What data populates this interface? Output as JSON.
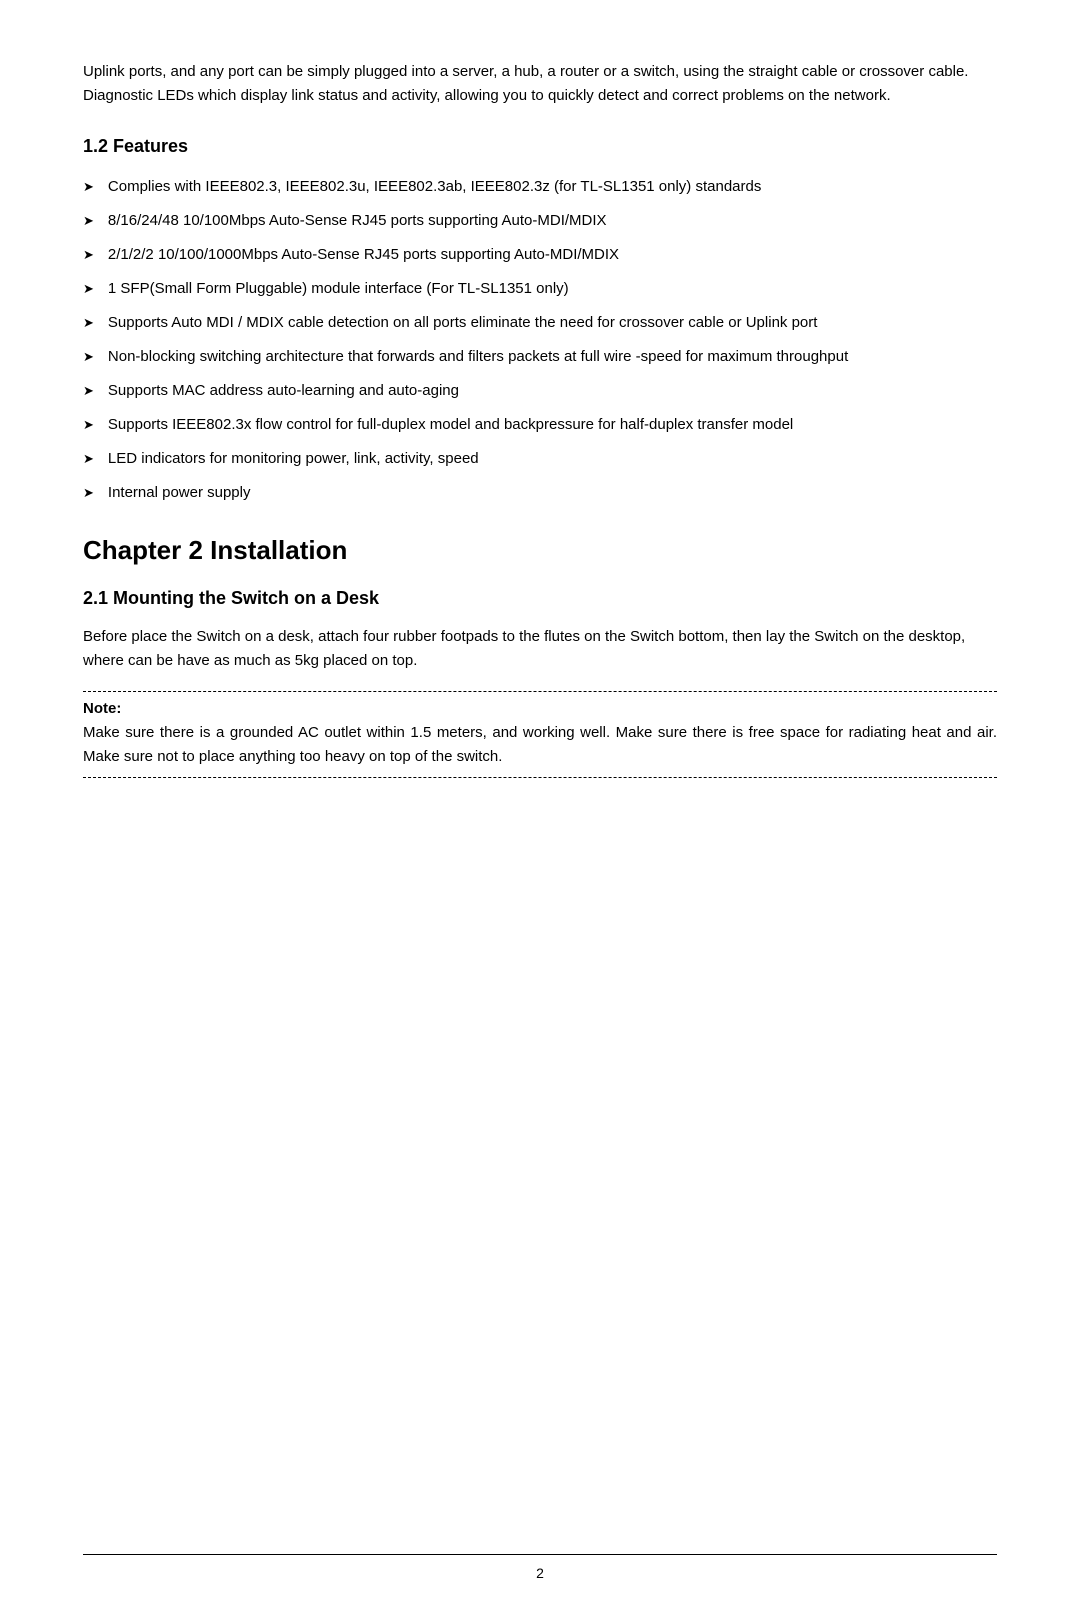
{
  "intro": {
    "text": "Uplink ports, and any port can be simply plugged into a server, a hub, a router or a switch, using the straight cable or crossover cable. Diagnostic LEDs which display link status and activity, allowing you to quickly detect and correct problems on the network."
  },
  "section12": {
    "heading": "1.2   Features",
    "bullets": [
      "Complies with IEEE802.3, IEEE802.3u, IEEE802.3ab, IEEE802.3z (for TL-SL1351 only) standards",
      "8/16/24/48 10/100Mbps Auto-Sense RJ45 ports supporting Auto-MDI/MDIX",
      "2/1/2/2 10/100/1000Mbps Auto-Sense RJ45 ports supporting Auto-MDI/MDIX",
      "1 SFP(Small Form Pluggable) module interface (For TL-SL1351 only)",
      "Supports Auto MDI / MDIX cable detection on all ports eliminate the need for crossover cable or Uplink port",
      "Non-blocking switching architecture that forwards and filters packets at full wire -speed for maximum throughput",
      "Supports MAC address auto-learning and auto-aging",
      "Supports IEEE802.3x flow control for full-duplex model and backpressure for half-duplex transfer model",
      "LED indicators for monitoring power, link, activity, speed",
      "Internal power supply"
    ],
    "arrow": "➤"
  },
  "chapter2": {
    "heading": "Chapter 2   Installation"
  },
  "section21": {
    "heading": "2.1   Mounting the Switch on a Desk",
    "body": "Before place the Switch on a desk, attach four rubber footpads to the flutes on the Switch bottom, then lay the Switch on the desktop, where can be have as much as 5kg placed on top.",
    "note_label": "Note:",
    "note_text": "Make sure there is a grounded AC outlet within 1.5 meters, and working well. Make sure there is free space for radiating heat and air. Make sure not to place anything too heavy on top of the switch."
  },
  "footer": {
    "page_number": "2"
  }
}
